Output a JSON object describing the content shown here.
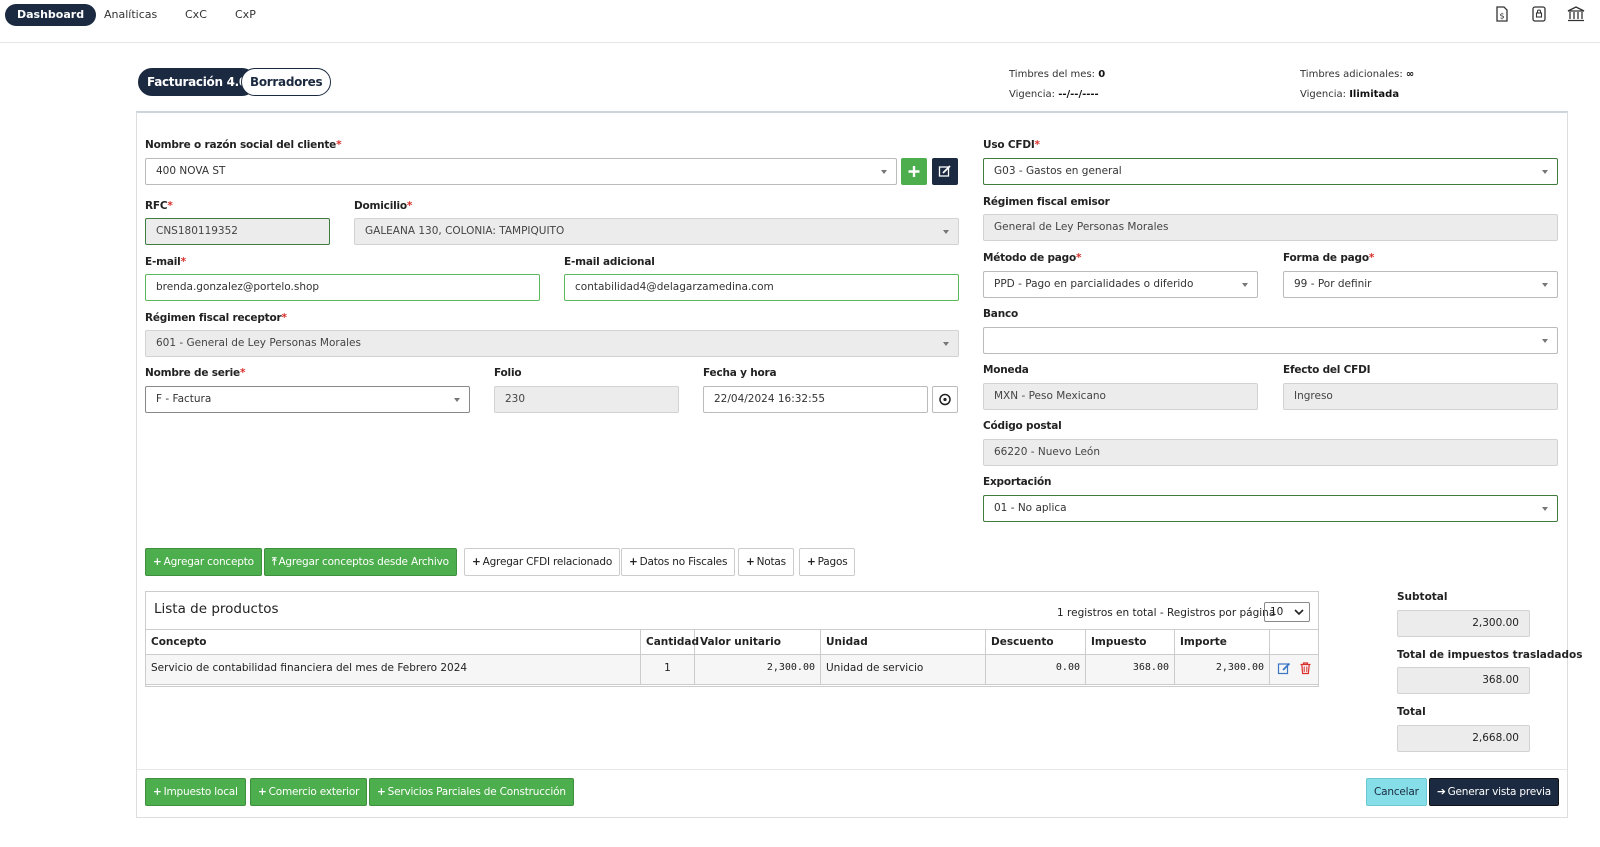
{
  "nav": {
    "tabs": [
      "Dashboard",
      "Analíticas",
      "CxC",
      "CxP"
    ],
    "icons": [
      "dollar-document-icon",
      "lock-icon",
      "bank-icon"
    ]
  },
  "subtabs": {
    "active": "Facturación 4.0",
    "inactive": "Borradores"
  },
  "stamps": {
    "month_label": "Timbres del mes:",
    "month_value": "0",
    "validity_label": "Vigencia:",
    "validity_value": "--/--/----",
    "extra_label": "Timbres adicionales:",
    "extra_value": "∞",
    "validity2_label": "Vigencia:",
    "validity2_value": "Ilimitada"
  },
  "form": {
    "client_label": "Nombre o razón social del cliente",
    "client_value": "400 NOVA ST",
    "rfc_label": "RFC",
    "rfc_value": "CNS180119352",
    "domicilio_label": "Domicilio",
    "domicilio_value": "GALEANA 130, COLONIA: TAMPIQUITO",
    "email_label": "E-mail",
    "email_value": "brenda.gonzalez@portelo.shop",
    "email2_label": "E-mail adicional",
    "email2_value": "contabilidad4@delagarzamedina.com",
    "regimen_receptor_label": "Régimen fiscal receptor",
    "regimen_receptor_value": "601 - General de Ley Personas Morales",
    "serie_label": "Nombre de serie",
    "serie_value": "F - Factura",
    "folio_label": "Folio",
    "folio_value": "230",
    "fecha_label": "Fecha y hora",
    "fecha_value": "22/04/2024 16:32:55",
    "uso_label": "Uso CFDI",
    "uso_value": "G03 - Gastos en general",
    "regimen_emisor_label": "Régimen fiscal emisor",
    "regimen_emisor_value": "General de Ley Personas Morales",
    "metodo_label": "Método de pago",
    "metodo_value": "PPD - Pago en parcialidades o diferido",
    "forma_label": "Forma de pago",
    "forma_value": "99 - Por definir",
    "banco_label": "Banco",
    "banco_value": "",
    "moneda_label": "Moneda",
    "moneda_value": "MXN - Peso Mexicano",
    "efecto_label": "Efecto del CFDI",
    "efecto_value": "Ingreso",
    "cp_label": "Código postal",
    "cp_value": "66220 - Nuevo León",
    "exportacion_label": "Exportación",
    "exportacion_value": "01 - No aplica",
    "required_mark": "*"
  },
  "actions": {
    "agregar_concepto": "Agregar concepto",
    "agregar_archivo": "Agregar conceptos desde Archivo",
    "agregar_cfdi": "Agregar CFDI relacionado",
    "datos_no_fiscales": "Datos no Fiscales",
    "notas": "Notas",
    "pagos": "Pagos"
  },
  "products": {
    "title": "Lista de productos",
    "info": "1 registros en total - Registros por página",
    "per_page": "10",
    "columns": [
      "Concepto",
      "Cantidad",
      "Valor unitario",
      "Unidad",
      "Descuento",
      "Impuesto",
      "Importe"
    ],
    "rows": [
      {
        "concepto": "Servicio de contabilidad financiera del mes de Febrero 2024",
        "cantidad": "1",
        "valor": "2,300.00",
        "unidad": "Unidad de servicio",
        "descuento": "0.00",
        "impuesto": "368.00",
        "importe": "2,300.00"
      }
    ]
  },
  "totals": {
    "subtotal_label": "Subtotal",
    "subtotal_value": "2,300.00",
    "impuestos_label": "Total de impuestos trasladados",
    "impuestos_value": "368.00",
    "total_label": "Total",
    "total_value": "2,668.00"
  },
  "footer": {
    "impuesto_local": "Impuesto local",
    "comercio_exterior": "Comercio exterior",
    "servicios_parciales": "Servicios Parciales de Construcción",
    "cancelar": "Cancelar",
    "generar": "Generar vista previa"
  },
  "colors": {
    "primary": "#1b2a40",
    "success": "#4cae4c",
    "cyan": "#86dfe8",
    "danger": "#d9302c"
  }
}
